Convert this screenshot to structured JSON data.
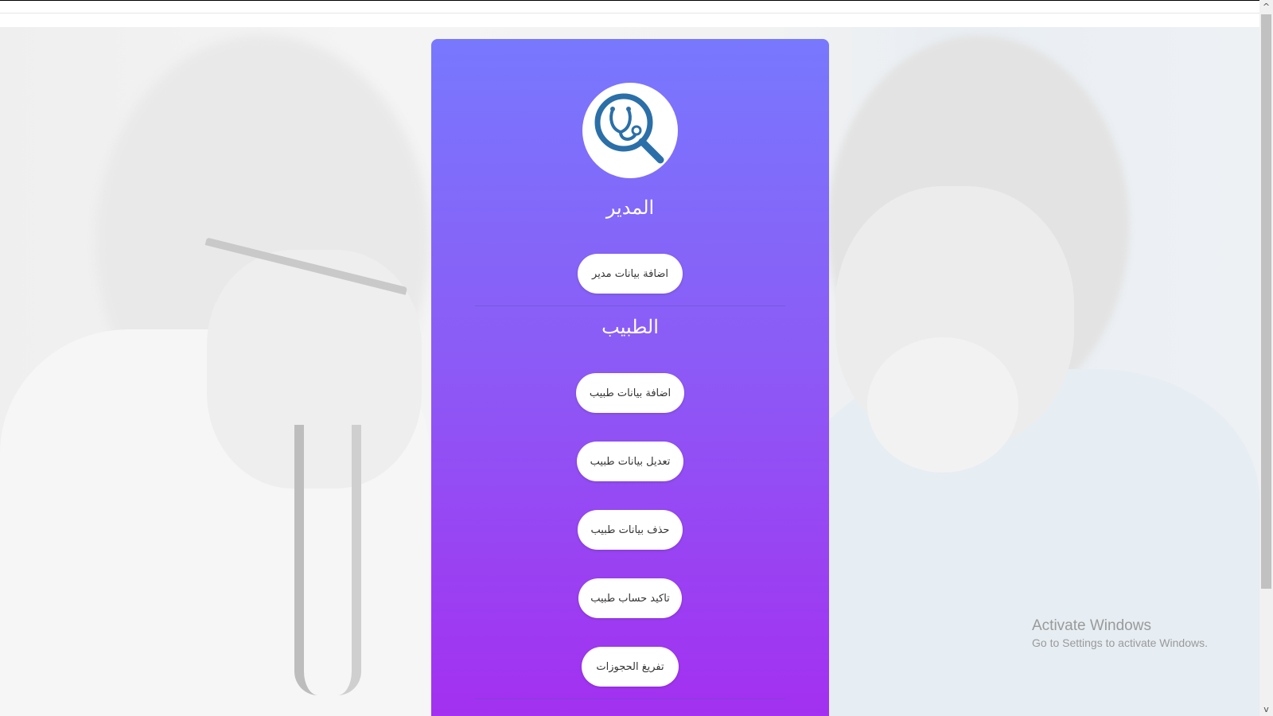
{
  "admin": {
    "title": "المدير",
    "add_button": "اضافة بيانات مدير"
  },
  "doctor": {
    "title": "الطبيب",
    "add_button": "اضافة بيانات طبيب",
    "edit_button": "تعديل بيانات طبيب",
    "delete_button": "حذف بيانات طبيب",
    "confirm_button": "تاكيد حساب طبيب",
    "clear_bookings_button": "تفريغ الحجوزات"
  },
  "logo": {
    "icon": "stethoscope-magnifier-icon",
    "color": "#2b6fa8"
  },
  "panel": {
    "gradient_top": "#7878fe",
    "gradient_bottom": "#a42ff0"
  },
  "watermark": {
    "title": "Activate Windows",
    "subtitle": "Go to Settings to activate Windows."
  },
  "scrollbar": {
    "up_icon": "^",
    "down_icon": "v"
  }
}
